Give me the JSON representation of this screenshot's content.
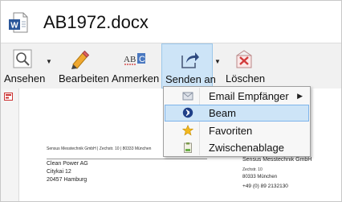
{
  "window": {
    "title": "AB1972.docx",
    "app_icon": "word-icon"
  },
  "toolbar": {
    "items": [
      {
        "label": "Ansehen",
        "icon": "magnifier-icon",
        "has_dropdown": true
      },
      {
        "label": "Bearbeiten",
        "icon": "pencil-icon",
        "has_dropdown": false
      },
      {
        "label": "Anmerken",
        "icon": "abc-annotate-icon",
        "has_dropdown": false
      },
      {
        "label": "Senden an",
        "icon": "share-icon",
        "has_dropdown": true,
        "active": true
      },
      {
        "label": "Löschen",
        "icon": "delete-icon",
        "has_dropdown": false
      }
    ]
  },
  "send_menu": {
    "items": [
      {
        "label": "Email Empfänger",
        "icon": "envelope-icon",
        "submenu": true
      },
      {
        "label": "Beam",
        "icon": "beam-icon",
        "highlighted": true
      },
      {
        "label": "Favoriten",
        "icon": "star-icon"
      },
      {
        "label": "Zwischenablage",
        "icon": "clipboard-icon"
      }
    ]
  },
  "document": {
    "sender_line": "Sensus Messtechnik GmbH | Zechstr. 10 | 80333 München",
    "recipient": [
      "Clean Power AG",
      "Citykai 12",
      "20457 Hamburg"
    ],
    "company_block": [
      "Sensus Messtechnik GmbH",
      "Zechstr. 10",
      "80333 München",
      "+49 (0) 89 2132130"
    ]
  }
}
